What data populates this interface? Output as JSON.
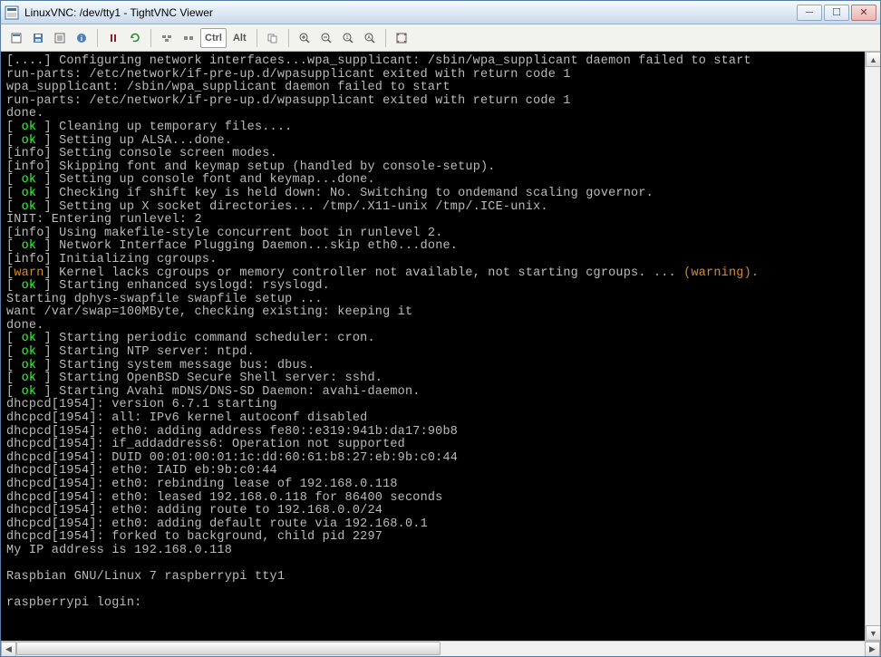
{
  "window": {
    "title": "LinuxVNC: /dev/tty1 - TightVNC Viewer"
  },
  "toolbar": {
    "new": "📄",
    "save": "💾",
    "options": "📋",
    "info": "ℹ",
    "pause": "||",
    "refresh": "🔄",
    "cad": "⛓",
    "ctrl_esc": "⌨",
    "ctrl": "Ctrl",
    "alt": "Alt",
    "copy": "📄",
    "zoom_in": "🔍",
    "zoom_out": "🔍",
    "zoom_100": "🔍",
    "zoom_auto": "🔍",
    "fullscreen": "⛶"
  },
  "terminal": {
    "lines": [
      {
        "segs": [
          {
            "t": "[....] Configuring network interfaces...wpa_supplicant: /sbin/wpa_supplicant daemon failed to start"
          }
        ]
      },
      {
        "segs": [
          {
            "t": "run-parts: /etc/network/if-pre-up.d/wpasupplicant exited with return code 1"
          }
        ]
      },
      {
        "segs": [
          {
            "t": "wpa_supplicant: /sbin/wpa_supplicant daemon failed to start"
          }
        ]
      },
      {
        "segs": [
          {
            "t": "run-parts: /etc/network/if-pre-up.d/wpasupplicant exited with return code 1"
          }
        ]
      },
      {
        "segs": [
          {
            "t": "done."
          }
        ]
      },
      {
        "segs": [
          {
            "t": "[ ",
            "c": "br"
          },
          {
            "t": "ok",
            "c": "ok"
          },
          {
            "t": " ] Cleaning up temporary files....",
            "c": "br"
          }
        ]
      },
      {
        "segs": [
          {
            "t": "[ ",
            "c": "br"
          },
          {
            "t": "ok",
            "c": "ok"
          },
          {
            "t": " ] Setting up ALSA...done.",
            "c": "br"
          }
        ]
      },
      {
        "segs": [
          {
            "t": "[",
            "c": "br"
          },
          {
            "t": "info",
            "c": "info"
          },
          {
            "t": "] Setting console screen modes.",
            "c": "br"
          }
        ]
      },
      {
        "segs": [
          {
            "t": "[",
            "c": "br"
          },
          {
            "t": "info",
            "c": "info"
          },
          {
            "t": "] Skipping font and keymap setup (handled by console-setup).",
            "c": "br"
          }
        ]
      },
      {
        "segs": [
          {
            "t": "[ ",
            "c": "br"
          },
          {
            "t": "ok",
            "c": "ok"
          },
          {
            "t": " ] Setting up console font and keymap...done.",
            "c": "br"
          }
        ]
      },
      {
        "segs": [
          {
            "t": "[ ",
            "c": "br"
          },
          {
            "t": "ok",
            "c": "ok"
          },
          {
            "t": " ] Checking if shift key is held down: No. Switching to ondemand scaling governor.",
            "c": "br"
          }
        ]
      },
      {
        "segs": [
          {
            "t": "[ ",
            "c": "br"
          },
          {
            "t": "ok",
            "c": "ok"
          },
          {
            "t": " ] Setting up X socket directories... /tmp/.X11-unix /tmp/.ICE-unix.",
            "c": "br"
          }
        ]
      },
      {
        "segs": [
          {
            "t": "INIT: Entering runlevel: 2"
          }
        ]
      },
      {
        "segs": [
          {
            "t": "[",
            "c": "br"
          },
          {
            "t": "info",
            "c": "info"
          },
          {
            "t": "] Using makefile-style concurrent boot in runlevel 2.",
            "c": "br"
          }
        ]
      },
      {
        "segs": [
          {
            "t": "[ ",
            "c": "br"
          },
          {
            "t": "ok",
            "c": "ok"
          },
          {
            "t": " ] Network Interface Plugging Daemon...skip eth0...done.",
            "c": "br"
          }
        ]
      },
      {
        "segs": [
          {
            "t": "[",
            "c": "br"
          },
          {
            "t": "info",
            "c": "info"
          },
          {
            "t": "] Initializing cgroups.",
            "c": "br"
          }
        ]
      },
      {
        "segs": [
          {
            "t": "[",
            "c": "br"
          },
          {
            "t": "warn",
            "c": "warn"
          },
          {
            "t": "] Kernel lacks cgroups or memory controller not available, not starting cgroups. ... ",
            "c": "br"
          },
          {
            "t": "(warning).",
            "c": "warn"
          }
        ]
      },
      {
        "segs": [
          {
            "t": "[ ",
            "c": "br"
          },
          {
            "t": "ok",
            "c": "ok"
          },
          {
            "t": " ] Starting enhanced syslogd: rsyslogd.",
            "c": "br"
          }
        ]
      },
      {
        "segs": [
          {
            "t": "Starting dphys-swapfile swapfile setup ..."
          }
        ]
      },
      {
        "segs": [
          {
            "t": "want /var/swap=100MByte, checking existing: keeping it"
          }
        ]
      },
      {
        "segs": [
          {
            "t": "done."
          }
        ]
      },
      {
        "segs": [
          {
            "t": "[ ",
            "c": "br"
          },
          {
            "t": "ok",
            "c": "ok"
          },
          {
            "t": " ] Starting periodic command scheduler: cron.",
            "c": "br"
          }
        ]
      },
      {
        "segs": [
          {
            "t": "[ ",
            "c": "br"
          },
          {
            "t": "ok",
            "c": "ok"
          },
          {
            "t": " ] Starting NTP server: ntpd.",
            "c": "br"
          }
        ]
      },
      {
        "segs": [
          {
            "t": "[ ",
            "c": "br"
          },
          {
            "t": "ok",
            "c": "ok"
          },
          {
            "t": " ] Starting system message bus: dbus.",
            "c": "br"
          }
        ]
      },
      {
        "segs": [
          {
            "t": "[ ",
            "c": "br"
          },
          {
            "t": "ok",
            "c": "ok"
          },
          {
            "t": " ] Starting OpenBSD Secure Shell server: sshd.",
            "c": "br"
          }
        ]
      },
      {
        "segs": [
          {
            "t": "[ ",
            "c": "br"
          },
          {
            "t": "ok",
            "c": "ok"
          },
          {
            "t": " ] Starting Avahi mDNS/DNS-SD Daemon: avahi-daemon.",
            "c": "br"
          }
        ]
      },
      {
        "segs": [
          {
            "t": "dhcpcd[1954]: version 6.7.1 starting"
          }
        ]
      },
      {
        "segs": [
          {
            "t": "dhcpcd[1954]: all: IPv6 kernel autoconf disabled"
          }
        ]
      },
      {
        "segs": [
          {
            "t": "dhcpcd[1954]: eth0: adding address fe80::e319:941b:da17:90b8"
          }
        ]
      },
      {
        "segs": [
          {
            "t": "dhcpcd[1954]: if_addaddress6: Operation not supported"
          }
        ]
      },
      {
        "segs": [
          {
            "t": "dhcpcd[1954]: DUID 00:01:00:01:1c:dd:60:61:b8:27:eb:9b:c0:44"
          }
        ]
      },
      {
        "segs": [
          {
            "t": "dhcpcd[1954]: eth0: IAID eb:9b:c0:44"
          }
        ]
      },
      {
        "segs": [
          {
            "t": "dhcpcd[1954]: eth0: rebinding lease of 192.168.0.118"
          }
        ]
      },
      {
        "segs": [
          {
            "t": "dhcpcd[1954]: eth0: leased 192.168.0.118 for 86400 seconds"
          }
        ]
      },
      {
        "segs": [
          {
            "t": "dhcpcd[1954]: eth0: adding route to 192.168.0.0/24"
          }
        ]
      },
      {
        "segs": [
          {
            "t": "dhcpcd[1954]: eth0: adding default route via 192.168.0.1"
          }
        ]
      },
      {
        "segs": [
          {
            "t": "dhcpcd[1954]: forked to background, child pid 2297"
          }
        ]
      },
      {
        "segs": [
          {
            "t": "My IP address is 192.168.0.118"
          }
        ]
      },
      {
        "segs": [
          {
            "t": " "
          }
        ]
      },
      {
        "segs": [
          {
            "t": "Raspbian GNU/Linux 7 raspberrypi tty1"
          }
        ]
      },
      {
        "segs": [
          {
            "t": " "
          }
        ]
      },
      {
        "segs": [
          {
            "t": "raspberrypi login: "
          }
        ]
      }
    ]
  }
}
